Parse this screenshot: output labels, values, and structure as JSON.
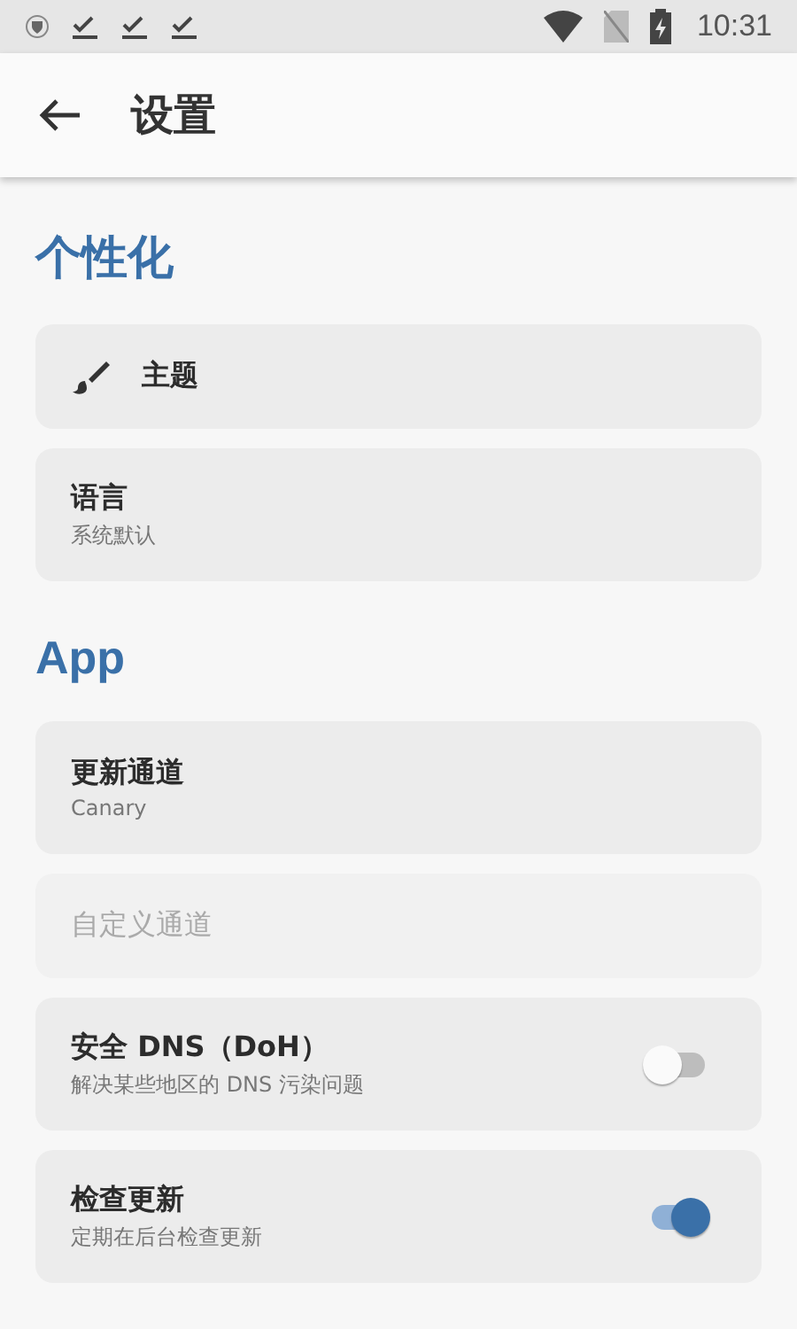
{
  "status_bar": {
    "time": "10:31"
  },
  "app_bar": {
    "title": "设置"
  },
  "sections": [
    {
      "title": "个性化",
      "items": [
        {
          "kind": "icon",
          "title": "主题"
        },
        {
          "kind": "text",
          "title": "语言",
          "summary": "系统默认"
        }
      ]
    },
    {
      "title": "App",
      "items": [
        {
          "kind": "text",
          "title": "更新通道",
          "summary": "Canary"
        },
        {
          "kind": "text",
          "title": "自定义通道",
          "disabled": true
        },
        {
          "kind": "switch",
          "title": "安全 DNS（DoH）",
          "summary": "解决某些地区的 DNS 污染问题",
          "on": false
        },
        {
          "kind": "switch",
          "title": "检查更新",
          "summary": "定期在后台检查更新",
          "on": true
        }
      ]
    }
  ]
}
